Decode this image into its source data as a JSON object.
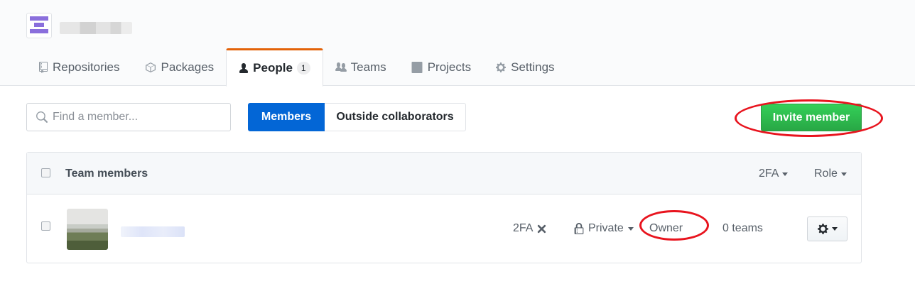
{
  "tabs": [
    {
      "label": "Repositories",
      "icon": "repo-icon"
    },
    {
      "label": "Packages",
      "icon": "package-icon"
    },
    {
      "label": "People",
      "icon": "person-icon",
      "count": "1",
      "selected": true
    },
    {
      "label": "Teams",
      "icon": "people-icon"
    },
    {
      "label": "Projects",
      "icon": "project-icon"
    },
    {
      "label": "Settings",
      "icon": "gear-icon"
    }
  ],
  "search": {
    "placeholder": "Find a member..."
  },
  "segmented": {
    "members_label": "Members",
    "outside_label": "Outside collaborators",
    "selected": "Members"
  },
  "invite_label": "Invite member",
  "table": {
    "title": "Team members",
    "filters": {
      "twofa": "2FA",
      "role": "Role"
    },
    "rows": [
      {
        "twofa": "2FA",
        "twofa_status": "disabled",
        "visibility": "Private",
        "role": "Owner",
        "teams": "0 teams"
      }
    ]
  },
  "colors": {
    "accent": "#0366d6",
    "invite": "#28a745",
    "tab_highlight": "#e36209",
    "annotation": "#e8141e"
  }
}
